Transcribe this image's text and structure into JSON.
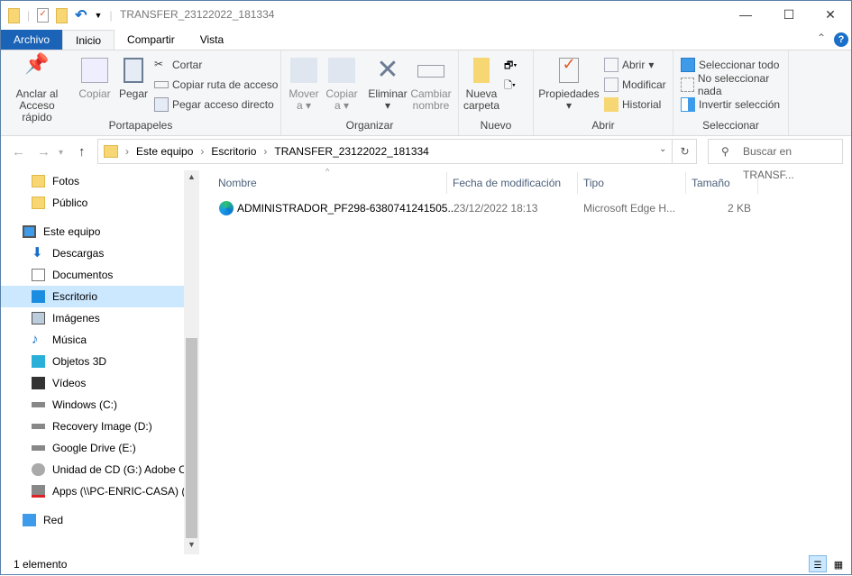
{
  "window": {
    "title": "TRANSFER_23122022_181334",
    "controls": {
      "minimize": "—",
      "maximize": "☐",
      "close": "✕"
    }
  },
  "tabs": [
    {
      "label": "Archivo"
    },
    {
      "label": "Inicio"
    },
    {
      "label": "Compartir"
    },
    {
      "label": "Vista"
    }
  ],
  "ribbon": {
    "portapapeles": {
      "label": "Portapapeles",
      "pin": "Anclar al Acceso rápido",
      "copy": "Copiar",
      "paste": "Pegar",
      "cut": "Cortar",
      "copy_path": "Copiar ruta de acceso",
      "paste_shortcut": "Pegar acceso directo"
    },
    "organizar": {
      "label": "Organizar",
      "move": "Mover a",
      "copy_to": "Copiar a",
      "delete": "Eliminar",
      "rename": "Cambiar nombre"
    },
    "nuevo": {
      "label": "Nuevo",
      "new_folder": "Nueva carpeta"
    },
    "abrir": {
      "label": "Abrir",
      "properties": "Propiedades",
      "open": "Abrir",
      "edit": "Modificar",
      "history": "Historial"
    },
    "seleccionar": {
      "label": "Seleccionar",
      "select_all": "Seleccionar todo",
      "select_none": "No seleccionar nada",
      "invert": "Invertir selección"
    }
  },
  "address": {
    "crumbs": [
      "Este equipo",
      "Escritorio",
      "TRANSFER_23122022_181334"
    ],
    "search_placeholder": "Buscar en TRANSF..."
  },
  "nav": [
    {
      "label": "Fotos",
      "icon": "folder-icon"
    },
    {
      "label": "Público",
      "icon": "folder-icon"
    },
    {
      "label": "Este equipo",
      "icon": "computer-icon"
    },
    {
      "label": "Descargas",
      "icon": "download-icon"
    },
    {
      "label": "Documentos",
      "icon": "document-icon"
    },
    {
      "label": "Escritorio",
      "icon": "desktop-icon",
      "selected": true
    },
    {
      "label": "Imágenes",
      "icon": "pictures-icon"
    },
    {
      "label": "Música",
      "icon": "music-icon"
    },
    {
      "label": "Objetos 3D",
      "icon": "cube-icon"
    },
    {
      "label": "Vídeos",
      "icon": "video-icon"
    },
    {
      "label": "Windows (C:)",
      "icon": "drive-icon"
    },
    {
      "label": "Recovery Image (D:)",
      "icon": "drive-icon"
    },
    {
      "label": "Google Drive (E:)",
      "icon": "drive-icon"
    },
    {
      "label": "Unidad de CD (G:) Adobe CS",
      "icon": "cd-icon"
    },
    {
      "label": "Apps (\\\\PC-ENRIC-CASA) (P",
      "icon": "network-drive-icon"
    },
    {
      "label": "Red",
      "icon": "network-icon"
    }
  ],
  "columns": [
    "Nombre",
    "Fecha de modificación",
    "Tipo",
    "Tamaño"
  ],
  "files": [
    {
      "name": "ADMINISTRADOR_PF298-6380741241505...",
      "date": "23/12/2022 18:13",
      "type": "Microsoft Edge H...",
      "size": "2 KB"
    }
  ],
  "status": {
    "count": "1 elemento"
  },
  "colors": {
    "accent": "#1a63b6",
    "selection": "#cce8ff"
  }
}
